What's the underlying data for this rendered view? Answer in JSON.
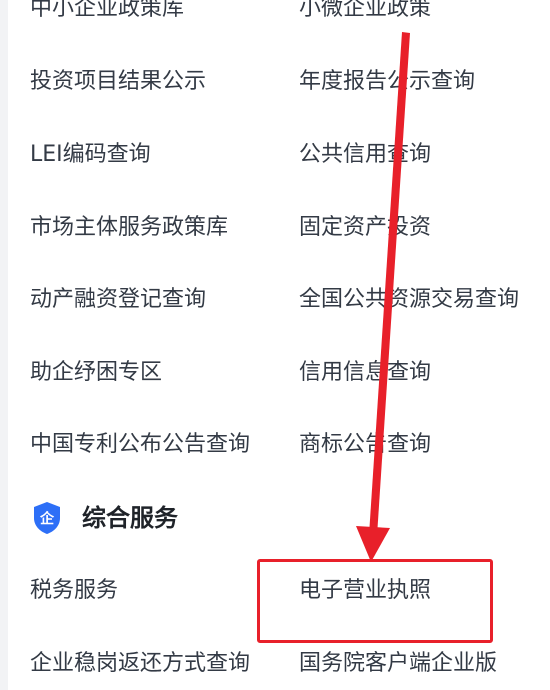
{
  "links_group_1": [
    {
      "left": "中小企业政策库",
      "right": "小微企业政策"
    },
    {
      "left": "投资项目结果公示",
      "right": "年度报告公示查询"
    },
    {
      "left": "LEI编码查询",
      "right": "公共信用查询"
    },
    {
      "left": "市场主体服务政策库",
      "right": "固定资产投资"
    },
    {
      "left": "动产融资登记查询",
      "right": "全国公共资源交易查询"
    },
    {
      "left": "助企纾困专区",
      "right": "信用信息查询"
    },
    {
      "left": "中国专利公布公告查询",
      "right": "商标公告查询"
    }
  ],
  "section": {
    "icon": "shield-icon",
    "icon_text": "企",
    "icon_color": "#2d6ff7",
    "title": "综合服务"
  },
  "links_group_2": [
    {
      "left": "税务服务",
      "right": "电子营业执照"
    },
    {
      "left": "企业稳岗返还方式查询",
      "right": "国务院客户端企业版"
    }
  ],
  "annotation": {
    "highlight_target": "电子营业执照",
    "highlight_color": "#e8202a"
  }
}
